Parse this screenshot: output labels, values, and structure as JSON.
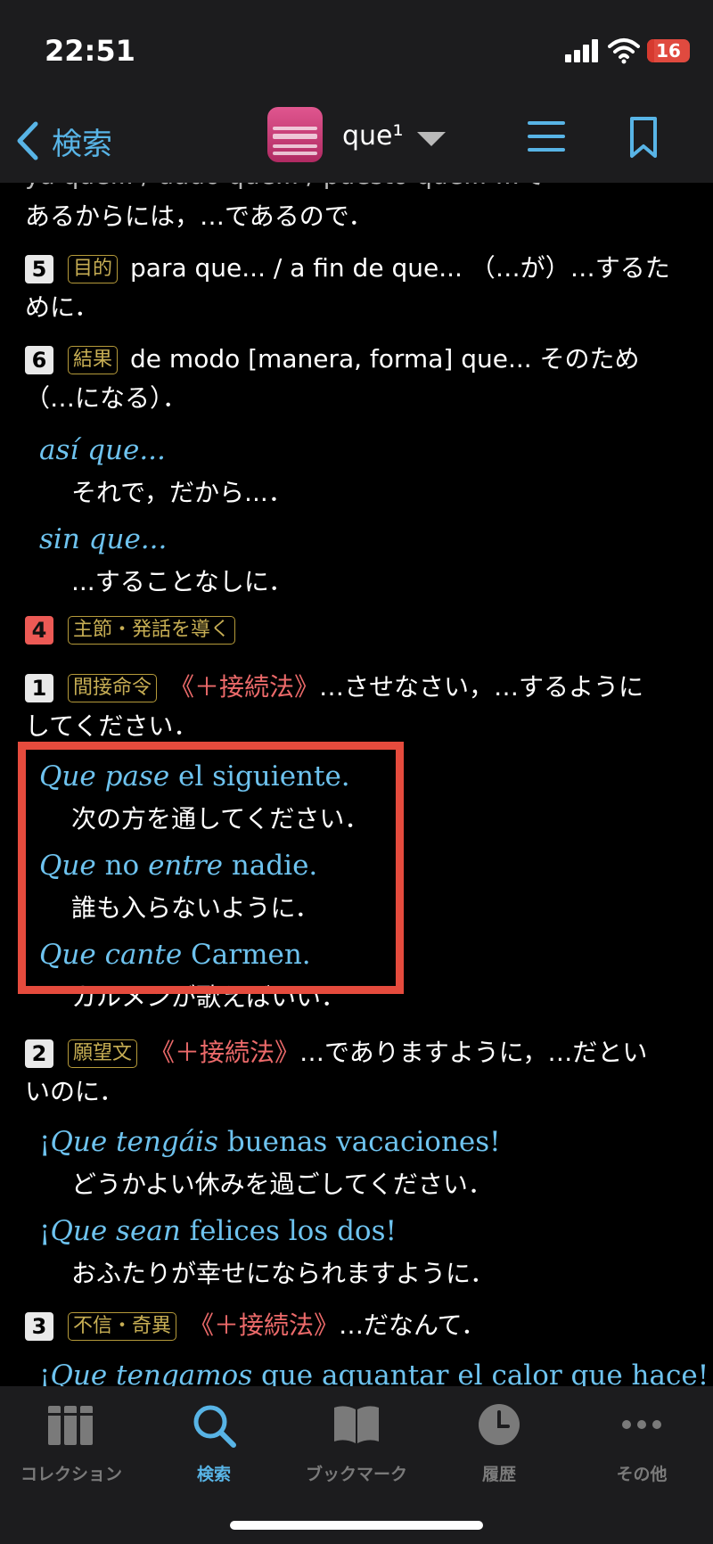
{
  "status": {
    "time": "22:51",
    "battery": "16"
  },
  "nav": {
    "back_label": "検索",
    "title": "que¹"
  },
  "content": {
    "partial_top": "ya que... / dado que... / puesto que... …で",
    "items": [
      {
        "text": "あるからには，…であるので．"
      },
      {
        "num": "5",
        "tag": "目的",
        "text": "para que... / a fin de que... （…が）…するた",
        "cont": "めに．"
      },
      {
        "num": "6",
        "tag": "結果",
        "text": "de modo [manera, forma] que... そのため",
        "cont": "（…になる）．"
      },
      {
        "ex_em": "así que...",
        "trans": "それで，だから...．"
      },
      {
        "ex_em": "sin que...",
        "trans": "...することなしに．"
      },
      {
        "num": "4",
        "tag": "主節・発話を導く"
      },
      {
        "num": "1",
        "tag": "間接命令",
        "sub": "《＋接続法》",
        "text": "…させなさい，…するように",
        "cont": "してください．"
      },
      {
        "ex_em1": "Que pase",
        "ex_rest": " el siguiente.",
        "trans": "次の方を通してください．"
      },
      {
        "ex_em1": "Que",
        "ex_mid": " no ",
        "ex_em2": "entre",
        "ex_rest": " nadie.",
        "trans": "誰も入らないように．"
      },
      {
        "ex_em1": "Que cante",
        "ex_rest": " Carmen.",
        "trans": "カルメンが歌えばいい．"
      },
      {
        "num": "2",
        "tag": "願望文",
        "sub": "《＋接続法》",
        "text": "…でありますように，…だとい",
        "cont": "いのに．"
      },
      {
        "ex_pre": "¡",
        "ex_em1": "Que tengáis",
        "ex_rest": " buenas vacaciones!",
        "trans": "どうかよい休みを過ごしてください．"
      },
      {
        "ex_pre": "¡",
        "ex_em1": "Que sean",
        "ex_rest": " felices los dos!",
        "trans": "おふたりが幸せになられますように．"
      },
      {
        "num": "3",
        "tag": "不信・奇異",
        "sub": "《＋接続法》",
        "text": "…だなんて．"
      },
      {
        "ex_pre": "¡",
        "ex_em1": "Que tengamos",
        "ex_rest": " que aguantar el calor que hace!"
      }
    ]
  },
  "tabs": [
    {
      "label": "コレクション",
      "icon": "books-icon"
    },
    {
      "label": "検索",
      "icon": "search-icon",
      "active": true
    },
    {
      "label": "ブックマーク",
      "icon": "book-icon"
    },
    {
      "label": "履歴",
      "icon": "clock-icon"
    },
    {
      "label": "その他",
      "icon": "more-icon"
    }
  ],
  "colors": {
    "accent": "#58b4e6",
    "example": "#6ec3ef",
    "tag": "#c7ae54",
    "subjunctive": "#ec6a6a",
    "highlight": "#e54b3d"
  }
}
